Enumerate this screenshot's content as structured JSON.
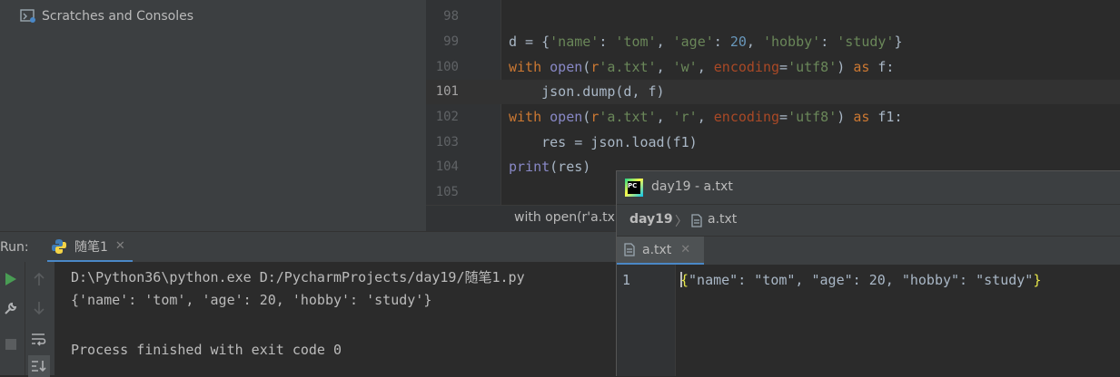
{
  "project_tree": {
    "item_label": "Scratches and Consoles"
  },
  "editor": {
    "lines": [
      {
        "n": "98",
        "code": ""
      },
      {
        "n": "99"
      },
      {
        "n": "100"
      },
      {
        "n": "101"
      },
      {
        "n": "102"
      },
      {
        "n": "103"
      },
      {
        "n": "104"
      },
      {
        "n": "105"
      }
    ],
    "breadcrumb": "with open(r'a.tx"
  },
  "run": {
    "label": "Run:",
    "tab_label": "随笔1",
    "output": [
      "D:\\Python36\\python.exe D:/PycharmProjects/day19/随笔1.py",
      "{'name': 'tom', 'age': 20, 'hobby': 'study'}",
      "",
      "Process finished with exit code 0"
    ]
  },
  "popup": {
    "title": "day19 - a.txt",
    "logo_text": "PC",
    "breadcrumb_project": "day19",
    "breadcrumb_file": "a.txt",
    "tab_label": "a.txt",
    "line_number": "1",
    "content_open": "{",
    "content_body": "\"name\": \"tom\", \"age\": 20, \"hobby\": \"study\"",
    "content_close": "}"
  },
  "colors": {
    "keyword": "#cc7832",
    "string": "#6a8759",
    "number": "#6897bb",
    "accent": "#4a88c7"
  }
}
